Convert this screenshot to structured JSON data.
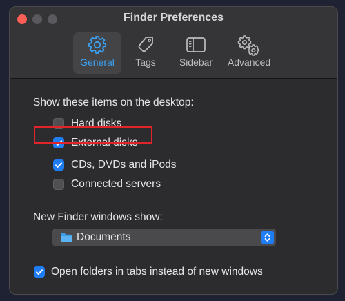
{
  "window": {
    "title": "Finder Preferences"
  },
  "tabs": [
    {
      "label": "General",
      "icon": "gear-icon",
      "active": true
    },
    {
      "label": "Tags",
      "icon": "tag-icon",
      "active": false
    },
    {
      "label": "Sidebar",
      "icon": "sidebar-icon",
      "active": false
    },
    {
      "label": "Advanced",
      "icon": "gears-icon",
      "active": false
    }
  ],
  "desktop": {
    "heading": "Show these items on the desktop:",
    "items": [
      {
        "label": "Hard disks",
        "checked": false
      },
      {
        "label": "External disks",
        "checked": true
      },
      {
        "label": "CDs, DVDs and iPods",
        "checked": true
      },
      {
        "label": "Connected servers",
        "checked": false
      }
    ]
  },
  "new_window": {
    "heading": "New Finder windows show:",
    "value": "Documents",
    "icon": "folder-icon"
  },
  "tabs_option": {
    "label": "Open folders in tabs instead of new windows",
    "checked": true
  },
  "colors": {
    "accent": "#1f7ef5",
    "active_tab_label": "#3aa3f6",
    "highlight_box": "#e0242a",
    "close_button": "#ff5f57"
  }
}
